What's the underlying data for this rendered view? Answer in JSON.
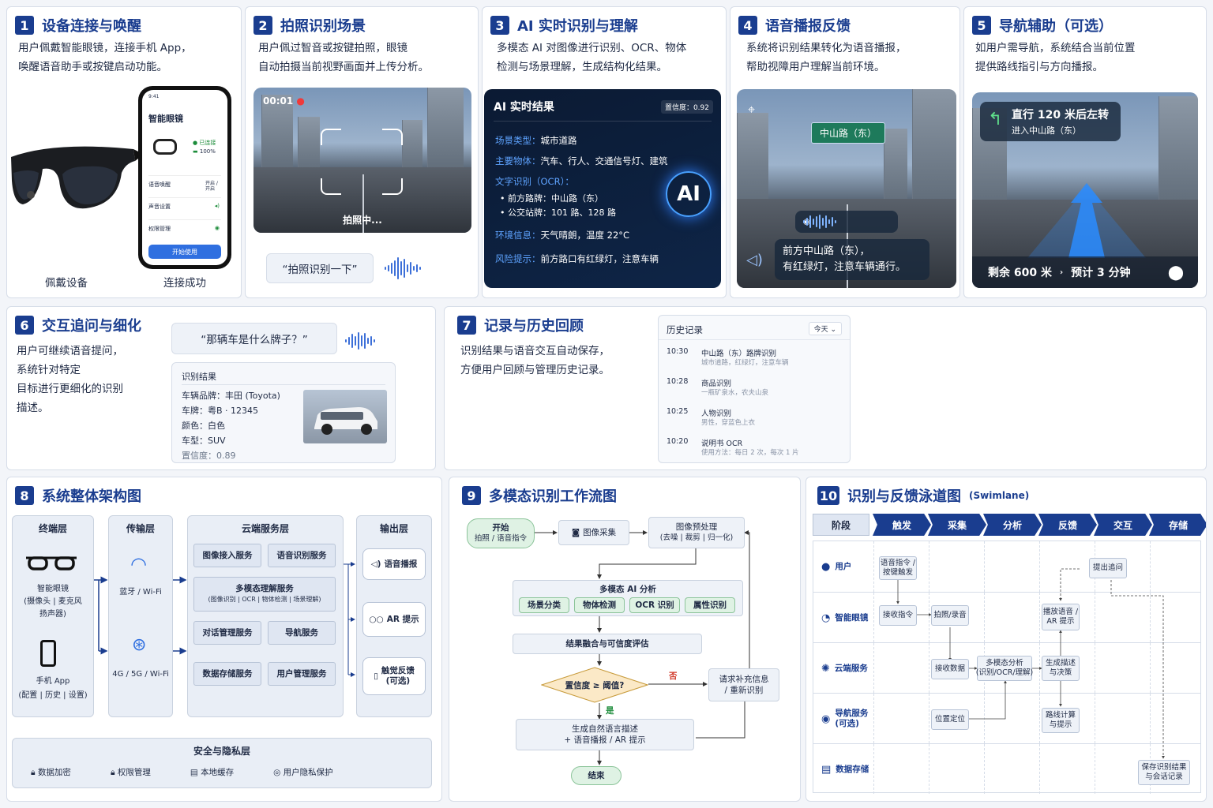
{
  "p1": {
    "num": "1",
    "title": "设备连接与唤醒",
    "desc1": "用户佩戴智能眼镜，连接手机 App，",
    "desc2": "唤醒语音助手或按键启动功能。",
    "cap_left": "佩戴设备",
    "cap_right": "连接成功",
    "phone": {
      "time": "9:41",
      "app_title": "智能眼镜",
      "status": "已连接",
      "battery": "100%",
      "row1": "语音唤醒",
      "row1_val": "开启 / 开启",
      "row2": "声音设置",
      "row3": "权限管理",
      "btn": "开始使用"
    }
  },
  "p2": {
    "num": "2",
    "title": "拍照识别场景",
    "desc1": "用户佩过智音或按键拍照，眼镜",
    "desc2": "自动拍摄当前视野画面并上传分析。",
    "rec": "00:01",
    "shooting": "拍照中...",
    "voice": "“拍照识别一下”"
  },
  "p3": {
    "num": "3",
    "title": "AI 实时识别与理解",
    "desc1": "多模态 AI 对图像进行识别、OCR、物体",
    "desc2": "检测与场景理解，生成结构化结果。",
    "card_title": "AI 实时结果",
    "conf": "置信度：0.92",
    "ai": "AI",
    "l1k": "场景类型：",
    "l1v": "城市道路",
    "l2k": "主要物体：",
    "l2v": "汽车、行人、交通信号灯、建筑",
    "l3k": "文字识别（OCR）：",
    "l3a": "前方路牌：中山路（东）",
    "l3b": "公交站牌：101 路、128 路",
    "l4k": "环境信息：",
    "l4v": "天气晴朗，温度 22°C",
    "l5k": "风险提示：",
    "l5v": "前方路口有红绿灯，注意车辆"
  },
  "p4": {
    "num": "4",
    "title": "语音播报反馈",
    "desc1": "系统将识别结果转化为语音播报，",
    "desc2": "帮助视障用户理解当前环境。",
    "sign": "中山路（东）",
    "msg1": "前方中山路（东），",
    "msg2": "有红绿灯，注意车辆通行。"
  },
  "p5": {
    "num": "5",
    "title": "导航辅助（可选）",
    "desc1": "如用户需导航，系统结合当前位置",
    "desc2": "提供路线指引与方向播报。",
    "nav1": "直行 120 米后左转",
    "nav2": "进入中山路（东）",
    "remain": "剩余 600 米",
    "eta": "预计 3 分钟"
  },
  "p6": {
    "num": "6",
    "title": "交互追问与细化",
    "d1": "用户可继续语音提问，",
    "d2": "系统针对特定",
    "d3": "目标进行更细化的识别",
    "d4": "描述。",
    "q": "“那辆车是什么牌子？”",
    "res_title": "识别结果",
    "r1": "车辆品牌：丰田 (Toyota)",
    "r2": "车牌：粤B · 12345",
    "r3": "颜色：白色",
    "r4": "车型：SUV",
    "r5": "置信度：0.89"
  },
  "p7": {
    "num": "7",
    "title": "记录与历史回顾",
    "d1": "识别结果与语音交互自动保存，",
    "d2": "方便用户回顾与管理历史记录。",
    "hist_title": "历史记录",
    "filter": "今天 ⌄",
    "items": [
      {
        "t": "10:30",
        "a": "中山路（东）路牌识别",
        "b": "城市道路，红绿灯，注意车辆"
      },
      {
        "t": "10:28",
        "a": "商品识别",
        "b": "一瓶矿泉水，农夫山泉"
      },
      {
        "t": "10:25",
        "a": "人物识别",
        "b": "男性，穿蓝色上衣"
      },
      {
        "t": "10:20",
        "a": "说明书 OCR",
        "b": "使用方法：每日 2 次，每次 1 片"
      }
    ]
  },
  "p8": {
    "num": "8",
    "title": "系统整体架构图",
    "c1": "终端层",
    "c2": "传输层",
    "c3": "云端服务层",
    "c4": "输出层",
    "glasses": "智能眼镜",
    "glasses_sub1": "(摄像头 | 麦克风",
    "glasses_sub2": "扬声器)",
    "app": "手机 App",
    "app_sub": "(配置 | 历史 | 设置)",
    "bt": "蓝牙 / Wi-Fi",
    "g4": "4G / 5G / Wi-Fi",
    "s1": "图像接入服务",
    "s2": "语音识别服务",
    "s3": "多模态理解服务",
    "s3sub": "(图像识别 | OCR | 物体检测 | 场景理解)",
    "s4": "对话管理服务",
    "s5": "导航服务",
    "s6": "数据存储服务",
    "s7": "用户管理服务",
    "o1": "语音播报",
    "o2": "AR 提示",
    "o3a": "触觉反馈",
    "o3b": "(可选)",
    "sec": "安全与隐私层",
    "k1": "数据加密",
    "k2": "权限管理",
    "k3": "本地缓存",
    "k4": "用户隐私保护"
  },
  "p9": {
    "num": "9",
    "title": "多模态识别工作流图",
    "start": "开始",
    "start_sub": "拍照 / 语音指令",
    "cap": "图像采集",
    "pre": "图像预处理",
    "pre_sub": "(去噪 | 裁剪 | 归一化)",
    "ai": "多模态 AI 分析",
    "a1": "场景分类",
    "a2": "物体检测",
    "a3": "OCR 识别",
    "a4": "属性识别",
    "fuse": "结果融合与可信度评估",
    "dec": "置信度 ≥ 阈值?",
    "no": "否",
    "yes": "是",
    "req1": "请求补充信息",
    "req2": "/ 重新识别",
    "gen1": "生成自然语言描述",
    "gen2": "+ 语音播报 / AR 提示",
    "end": "结束"
  },
  "p10": {
    "num": "10",
    "title": "识别与反馈泳道图",
    "title_sub": "(Swimlane)",
    "stage_hdr": "阶段",
    "stages": [
      "触发",
      "采集",
      "分析",
      "反馈",
      "交互",
      "存储"
    ],
    "rows": [
      "用户",
      "智能眼镜",
      "云端服务",
      "导航服务\n(可选)",
      "数据存储"
    ],
    "b_voice": "语音指令 /\n按键触发",
    "b_follow": "提出追问",
    "b_recv": "接收指令",
    "b_shoot": "拍照/录音",
    "b_play": "播放语音 /\nAR 提示",
    "b_data": "接收数据",
    "b_mm": "多模态分析\n(识别/OCR/理解)",
    "b_gen": "生成描述\n与决策",
    "b_loc": "位置定位",
    "b_route": "路线计算\n与提示",
    "b_save": "保存识别结果\n与会话记录"
  }
}
